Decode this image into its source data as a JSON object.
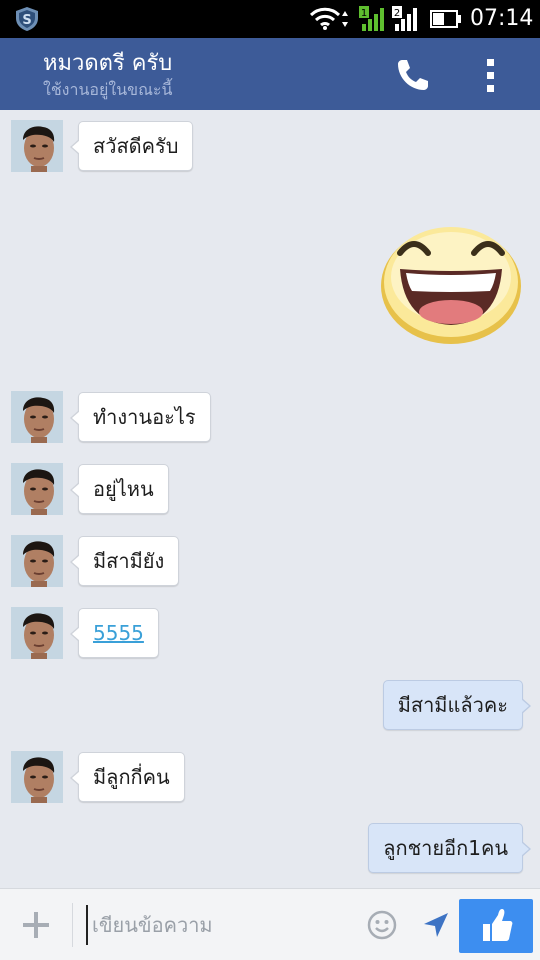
{
  "status_bar": {
    "time": "07:14",
    "sim1_label": "1",
    "sim2_label": "2",
    "icons": [
      "shield-icon",
      "wifi-icon",
      "signal-sim1-icon",
      "signal-sim2-icon",
      "battery-icon"
    ]
  },
  "header": {
    "contact_name": "หมวดตรี ครับ",
    "presence": "ใช้งานอยู่ในขณะนี้",
    "icons": [
      "phone-icon",
      "more-vertical-icon"
    ],
    "background_color": "#3d5b98"
  },
  "messages": [
    {
      "direction": "in",
      "text": "สวัสดีครับ"
    },
    {
      "direction": "out",
      "type": "sticker",
      "sticker": "laughing-face-sticker"
    },
    {
      "direction": "in",
      "text": "ทำงานอะไร"
    },
    {
      "direction": "in",
      "text": "อยู่ไหน"
    },
    {
      "direction": "in",
      "text": "มีสามียัง"
    },
    {
      "direction": "in",
      "text": "5555",
      "is_link": true
    },
    {
      "direction": "out",
      "text": "มีสามีแล้วคะ"
    },
    {
      "direction": "in",
      "text": "มีลูกกี่คน"
    },
    {
      "direction": "out",
      "text": "ลูกชายอีก1คน"
    }
  ],
  "composer": {
    "placeholder": "เขียนข้อความ",
    "icons": [
      "plus-icon",
      "emoji-icon",
      "location-arrow-icon",
      "thumbs-up-icon"
    ],
    "like_button_color": "#3d8ef0"
  },
  "colors": {
    "incoming_bubble": "#ffffff",
    "outgoing_bubble": "#d8e5f8",
    "link": "#3aa0d8",
    "chat_background": "#e6e9ef"
  }
}
